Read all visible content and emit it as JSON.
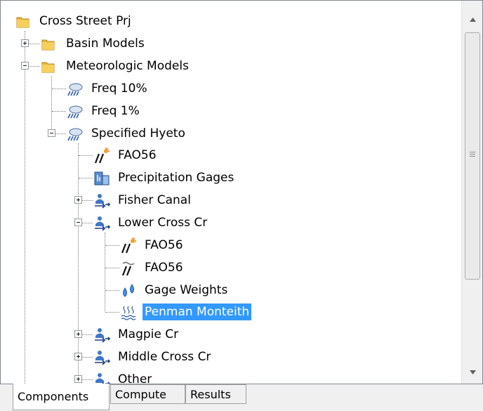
{
  "tree": {
    "rows": [
      {
        "label": "Cross Street Prj",
        "icon": "folder-icon"
      },
      {
        "label": "Basin Models",
        "icon": "folder-icon",
        "expander": "plus"
      },
      {
        "label": "Meteorologic Models",
        "icon": "folder-icon",
        "expander": "minus"
      },
      {
        "label": "Freq 10%",
        "icon": "meteorologic-model-icon"
      },
      {
        "label": "Freq 1%",
        "icon": "meteorologic-model-icon"
      },
      {
        "label": "Specified Hyeto",
        "icon": "meteorologic-model-icon",
        "expander": "minus"
      },
      {
        "label": "FAO56",
        "icon": "shortwave-radiation-icon"
      },
      {
        "label": "Precipitation Gages",
        "icon": "precipitation-gages-icon"
      },
      {
        "label": "Fisher Canal",
        "icon": "subbasin-icon",
        "expander": "plus"
      },
      {
        "label": "Lower Cross Cr",
        "icon": "subbasin-icon",
        "expander": "minus"
      },
      {
        "label": "FAO56",
        "icon": "shortwave-radiation-icon"
      },
      {
        "label": "FAO56",
        "icon": "longwave-radiation-icon"
      },
      {
        "label": "Gage Weights",
        "icon": "gage-weights-icon"
      },
      {
        "label": "Penman Monteith",
        "icon": "evapotranspiration-icon",
        "selected": true
      },
      {
        "label": "Magpie Cr",
        "icon": "subbasin-icon",
        "expander": "plus"
      },
      {
        "label": "Middle Cross Cr",
        "icon": "subbasin-icon",
        "expander": "plus"
      },
      {
        "label": "Other",
        "icon": "subbasin-icon",
        "expander": "plus"
      }
    ]
  },
  "tabs": [
    {
      "label": "Components",
      "active": true
    },
    {
      "label": "Compute",
      "active": false
    },
    {
      "label": "Results",
      "active": false
    }
  ],
  "colors": {
    "selection": "#3399ff",
    "folder": "#f5c242",
    "panel_border": "#828790"
  }
}
